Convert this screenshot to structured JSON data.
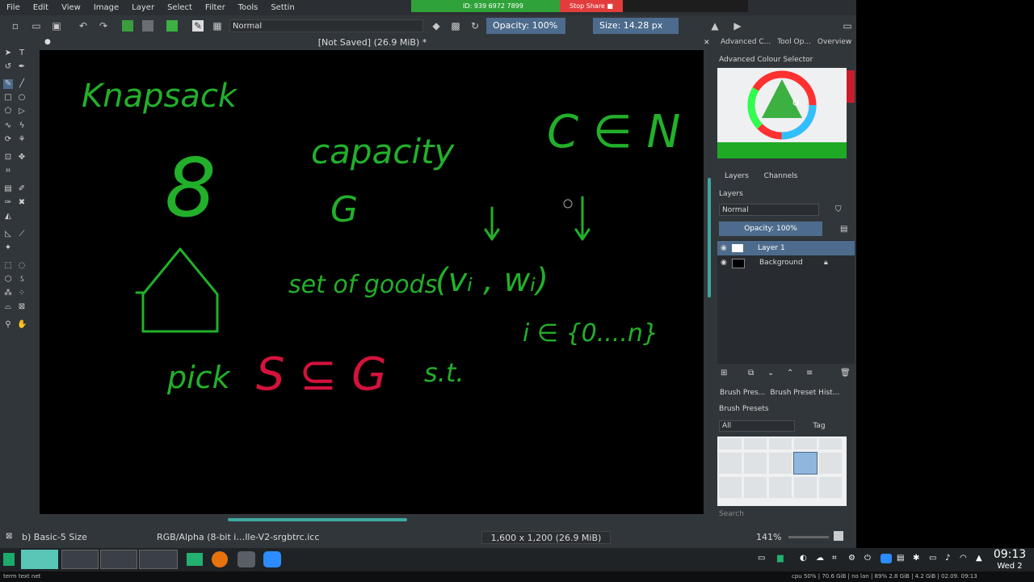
{
  "menu": [
    "File",
    "Edit",
    "View",
    "Image",
    "Layer",
    "Select",
    "Filter",
    "Tools",
    "Settin"
  ],
  "zoom_share": {
    "id_text": "ID: 939 6972 7899",
    "stop_label": "Stop Share"
  },
  "toolbar": {
    "blend_mode": "Normal",
    "opacity_label": "Opacity: 100%",
    "size_label": "Size: 14.28 px"
  },
  "document": {
    "title": "[Not Saved]  (26.9 MiB) *"
  },
  "docker_tabs": [
    "Advanced C...",
    "Tool Op...",
    "Overview"
  ],
  "color_selector": {
    "title": "Advanced Colour Selector"
  },
  "layers_panel": {
    "tabs": [
      "Layers",
      "Channels"
    ],
    "title": "Layers",
    "blend": "Normal",
    "opacity": "Opacity:  100%",
    "layers": [
      {
        "name": "Layer 1",
        "selected": true
      },
      {
        "name": "Background",
        "selected": false
      }
    ]
  },
  "brush_panel": {
    "tabs": [
      "Brush Pres...",
      "Brush Preset Hist..."
    ],
    "title": "Brush Presets",
    "filter": "All",
    "tag_label": "Tag",
    "search_placeholder": "Search"
  },
  "status": {
    "brush": "b) Basic-5 Size",
    "color_profile": "RGB/Alpha (8-bit i…lle-V2-srgbtrc.icc",
    "dimensions": "1,600 x 1,200 (26.9 MiB)",
    "zoom": "141%"
  },
  "canvas_text": {
    "green": [
      "Knapsack",
      "8",
      "capacity",
      "C ∈ N",
      "G",
      "set of goods",
      "(vᵢ , wᵢ)",
      "i ∈ {0....n}",
      "pick",
      "s.t."
    ],
    "red": [
      "S ⊆ G"
    ]
  },
  "taskbar": {
    "clock": "09:13",
    "day": "Wed 2",
    "sysline_left": "term  text  net",
    "sysline_right": "cpu  50%  |  70.6 GiB  |  no lan  |  89%  2.8 GiB  |  4.2 GiB  |  02.09.  09:13"
  },
  "colors": {
    "ink_green": "#22b02a",
    "ink_red": "#d4123c",
    "accent_blue": "#4d6b8c"
  }
}
